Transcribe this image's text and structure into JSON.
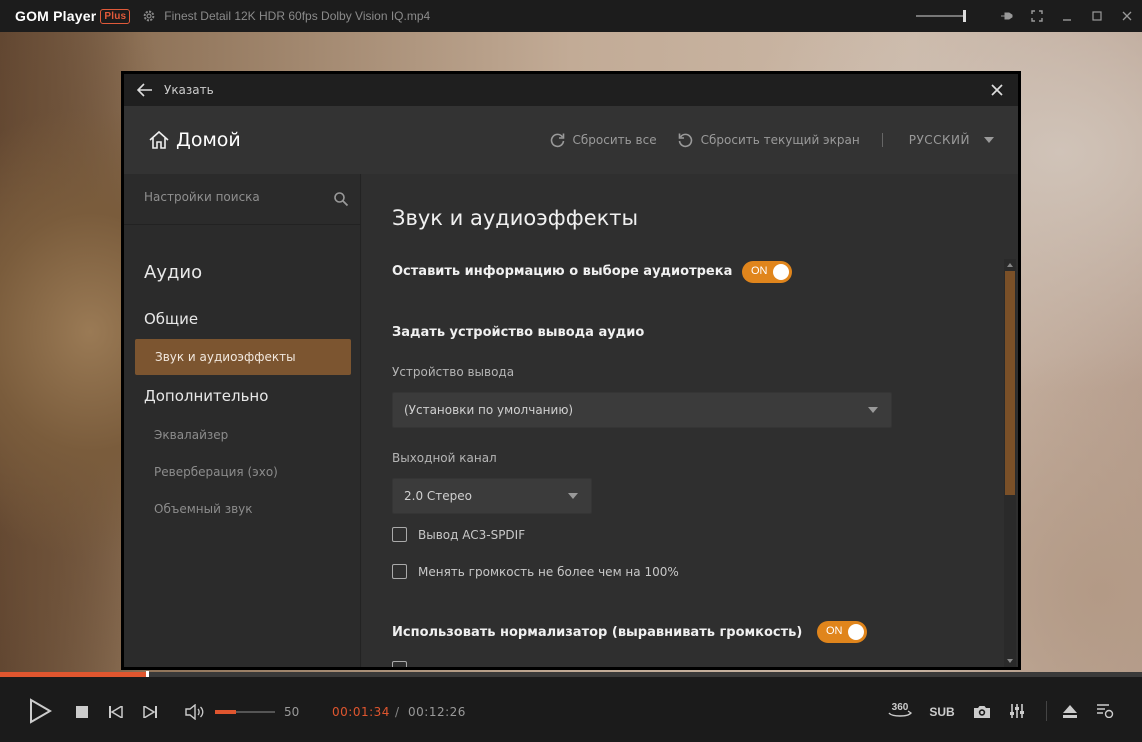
{
  "titlebar": {
    "app_name": "GOM Player",
    "badge": "Plus",
    "filename": "Finest Detail 12K HDR 60fps   Dolby Vision IQ.mp4"
  },
  "dialog": {
    "title": "Указать",
    "header": {
      "home_label": "Домой",
      "reset_all": "Сбросить все",
      "reset_current": "Сбросить текущий экран",
      "language": "РУССКИЙ"
    },
    "sidebar": {
      "search_placeholder": "Настройки поиска",
      "section_audio": "Аудио",
      "section_general": "Общие",
      "active_item": "Звук и аудиоэффекты",
      "section_advanced": "Дополнительно",
      "sub_items": [
        "Эквалайзер",
        "Реверберация (эхо)",
        "Объемный звук"
      ]
    },
    "content": {
      "heading": "Звук и аудиоэффекты",
      "keep_track_info": "Оставить информацию о выборе аудиотрека",
      "keep_track_toggle": "ON",
      "set_output_heading": "Задать устройство вывода аудио",
      "output_device_label": "Устройство вывода",
      "output_device_value": "(Установки по умолчанию)",
      "output_channel_label": "Выходной канал",
      "output_channel_value": "2.0 Стерео",
      "ac3_label": "Вывод AC3-SPDIF",
      "volume_limit_label": "Менять громкость не более чем на 100%",
      "normalizer_label": "Использовать нормализатор (выравнивать громкость)",
      "normalizer_toggle": "ON"
    }
  },
  "controls": {
    "volume_value": "50",
    "volume_level": 0.35,
    "time_current": "00:01:34",
    "time_separator": "/",
    "time_total": "00:12:26",
    "progress": 0.128,
    "vr_label": "360",
    "sub_label": "SUB"
  },
  "colors": {
    "accent": "#e0562f",
    "toggle": "#e0851c",
    "active_item": "#7c5530"
  }
}
